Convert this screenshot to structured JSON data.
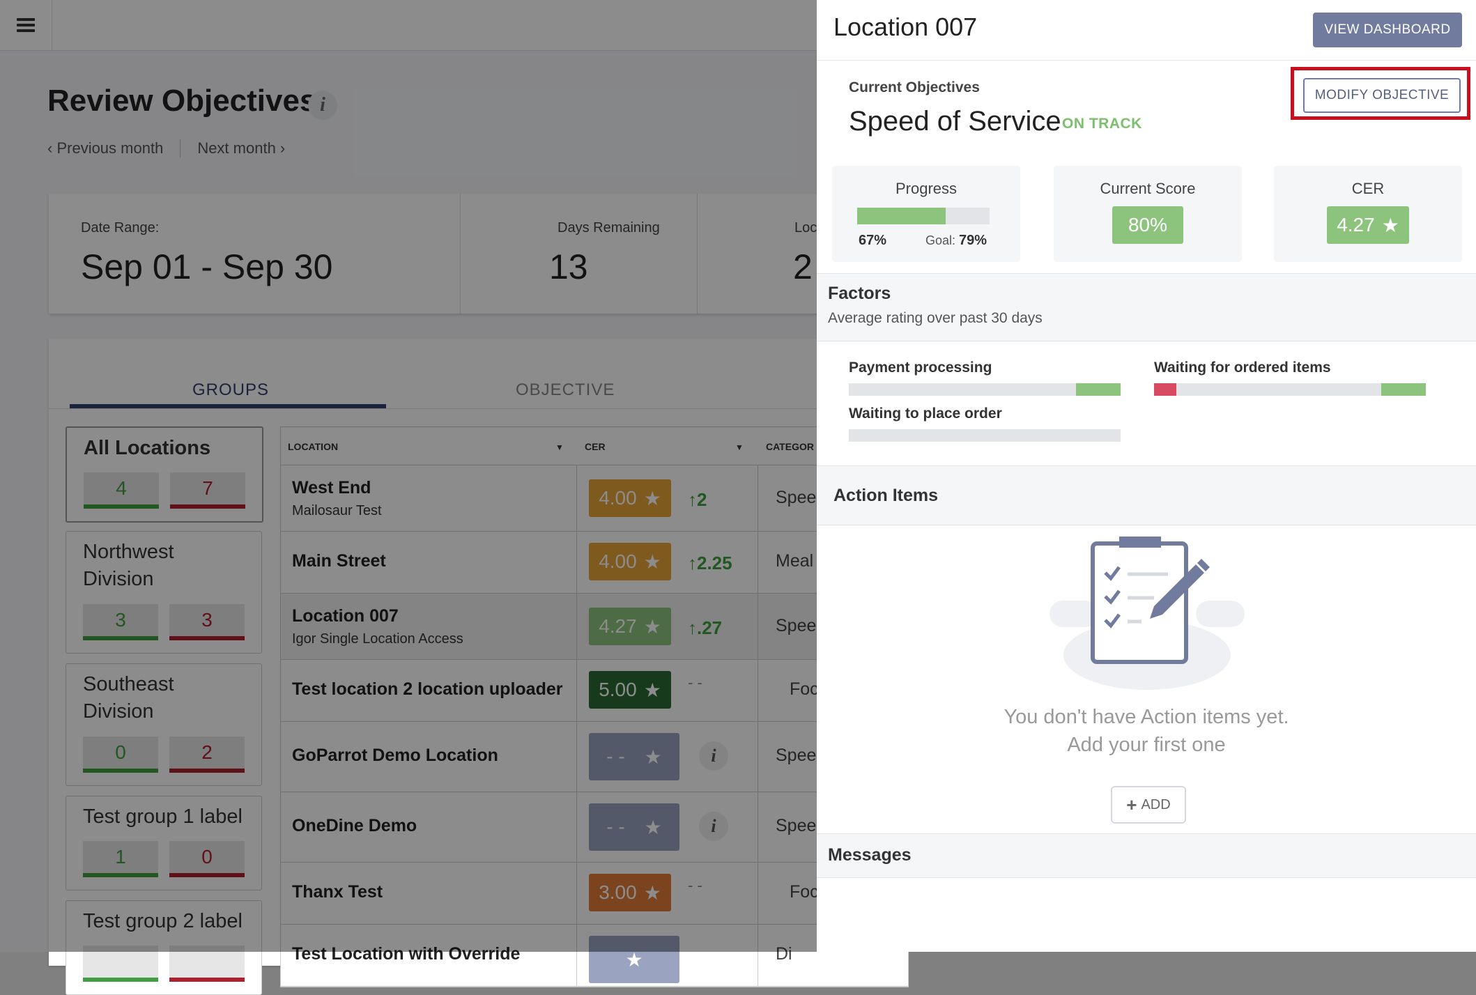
{
  "background_app": {
    "page_title": "Review Objectives",
    "prev_month": "Previous month",
    "next_month": "Next month",
    "summary": {
      "date_range_label": "Date Range:",
      "date_range_value": "Sep 01 - Sep 30",
      "days_remaining_label": "Days Remaining",
      "days_remaining_value": "13",
      "locations_label": "Loc",
      "locations_value": "2"
    },
    "tabs": [
      "GROUPS",
      "OBJECTIVE"
    ],
    "groups": [
      {
        "name": "All Locations",
        "green": "4",
        "red": "7"
      },
      {
        "name": "Northwest Division",
        "green": "3",
        "red": "3"
      },
      {
        "name": "Southeast Division",
        "green": "0",
        "red": "2"
      },
      {
        "name": "Test group 1 label",
        "green": "1",
        "red": "0"
      },
      {
        "name": "Test group 2 label",
        "green": "",
        "red": ""
      }
    ],
    "table": {
      "columns": [
        "LOCATION",
        "CER",
        "CATEGOR"
      ],
      "rows": [
        {
          "location": "West End",
          "sub": "Mailosaur Test",
          "cer": "4.00",
          "trend": "2",
          "category": "Spee"
        },
        {
          "location": "Main Street",
          "sub": "",
          "cer": "4.00",
          "trend": "2.25",
          "category": "Meal"
        },
        {
          "location": "Location 007",
          "sub": "Igor Single Location Access",
          "cer": "4.27",
          "trend": ".27",
          "category": "Spee"
        },
        {
          "location": "Test location 2 location uploader",
          "sub": "",
          "cer": "5.00",
          "trend": "- -",
          "category": "Foc"
        },
        {
          "location": "GoParrot Demo Location",
          "sub": "",
          "cer": "- -",
          "trend": "",
          "category": "Spee"
        },
        {
          "location": "OneDine Demo",
          "sub": "",
          "cer": "- -",
          "trend": "",
          "category": "Spee"
        },
        {
          "location": "Thanx Test",
          "sub": "",
          "cer": "3.00",
          "trend": "- -",
          "category": "Foc"
        },
        {
          "location": "Test Location with Override",
          "sub": "",
          "cer": "",
          "trend": "",
          "category": "Di"
        }
      ]
    }
  },
  "panel": {
    "title": "Location 007",
    "view_dashboard": "VIEW DASHBOARD",
    "current_objectives_label": "Current Objectives",
    "objective_name": "Speed of Service",
    "status": "ON TRACK",
    "modify_objective": "MODIFY OBJECTIVE",
    "progress": {
      "label": "Progress",
      "value_pct": 67,
      "value_text": "67%",
      "goal_label": "Goal:",
      "goal_text": "79%"
    },
    "current_score": {
      "label": "Current Score",
      "value": "80%"
    },
    "cer": {
      "label": "CER",
      "value": "4.27"
    },
    "factors": {
      "title": "Factors",
      "subtitle": "Average rating over past 30 days",
      "items": [
        {
          "label": "Payment processing"
        },
        {
          "label": "Waiting for ordered items"
        },
        {
          "label": "Waiting to place order"
        }
      ]
    },
    "action_items": {
      "title": "Action Items",
      "empty_line1": "You don't have Action items yet.",
      "empty_line2": "Add your first one",
      "add_label": "ADD"
    },
    "messages": {
      "title": "Messages"
    }
  },
  "colors": {
    "accent_navy": "#30416e",
    "button_slate": "#717b9d",
    "good_green": "#8cc47d",
    "badge_amber": "#e6a53a",
    "badge_orange": "#e07d3a",
    "badge_darkgreen": "#2b6a35",
    "badge_gray": "#9aa3bf",
    "alert_red": "#c8101e"
  }
}
